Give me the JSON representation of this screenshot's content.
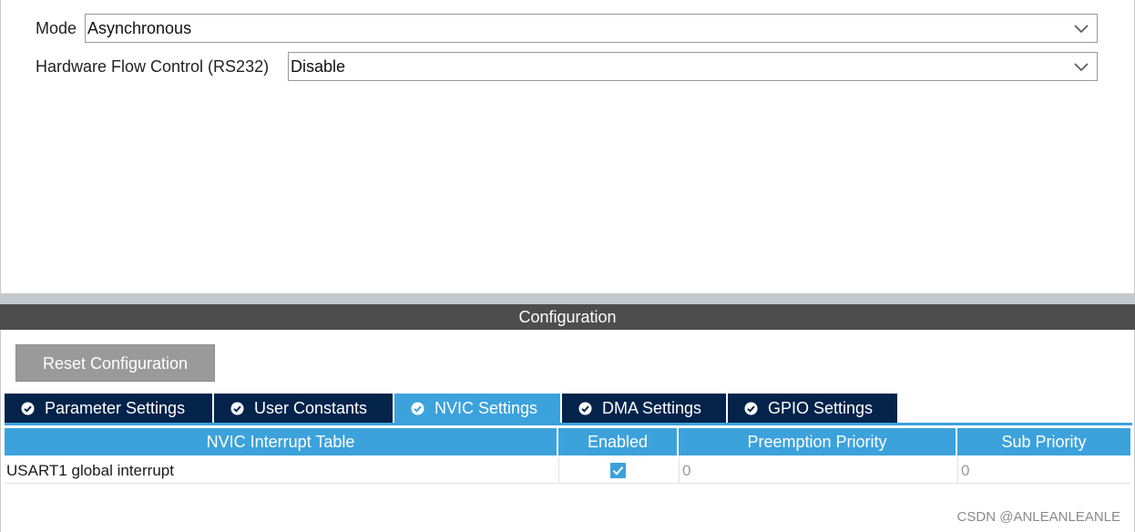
{
  "mode_panel": {
    "mode": {
      "label": "Mode",
      "value": "Asynchronous"
    },
    "flow_control": {
      "label": "Hardware Flow Control (RS232)",
      "value": "Disable"
    }
  },
  "configuration": {
    "title": "Configuration",
    "reset_label": "Reset Configuration",
    "tabs": [
      {
        "label": "Parameter Settings",
        "active": false
      },
      {
        "label": "User Constants",
        "active": false
      },
      {
        "label": "NVIC Settings",
        "active": true
      },
      {
        "label": "DMA Settings",
        "active": false
      },
      {
        "label": "GPIO Settings",
        "active": false
      }
    ],
    "nvic_table": {
      "columns": [
        "NVIC Interrupt Table",
        "Enabled",
        "Preemption Priority",
        "Sub Priority"
      ],
      "rows": [
        {
          "name": "USART1 global interrupt",
          "enabled": true,
          "preemption_priority": "0",
          "sub_priority": "0"
        }
      ]
    }
  },
  "watermark": "CSDN @ANLEANLEANLE",
  "colors": {
    "accent": "#3ca2dc",
    "tab_dark": "#03234b",
    "header_dark": "#4d4d4d",
    "button_gray": "#9a9a9a"
  },
  "icons": {
    "tab_status": "check-circle-icon",
    "dropdown": "chevron-down-icon",
    "enabled": "checkbox-checked-icon"
  }
}
